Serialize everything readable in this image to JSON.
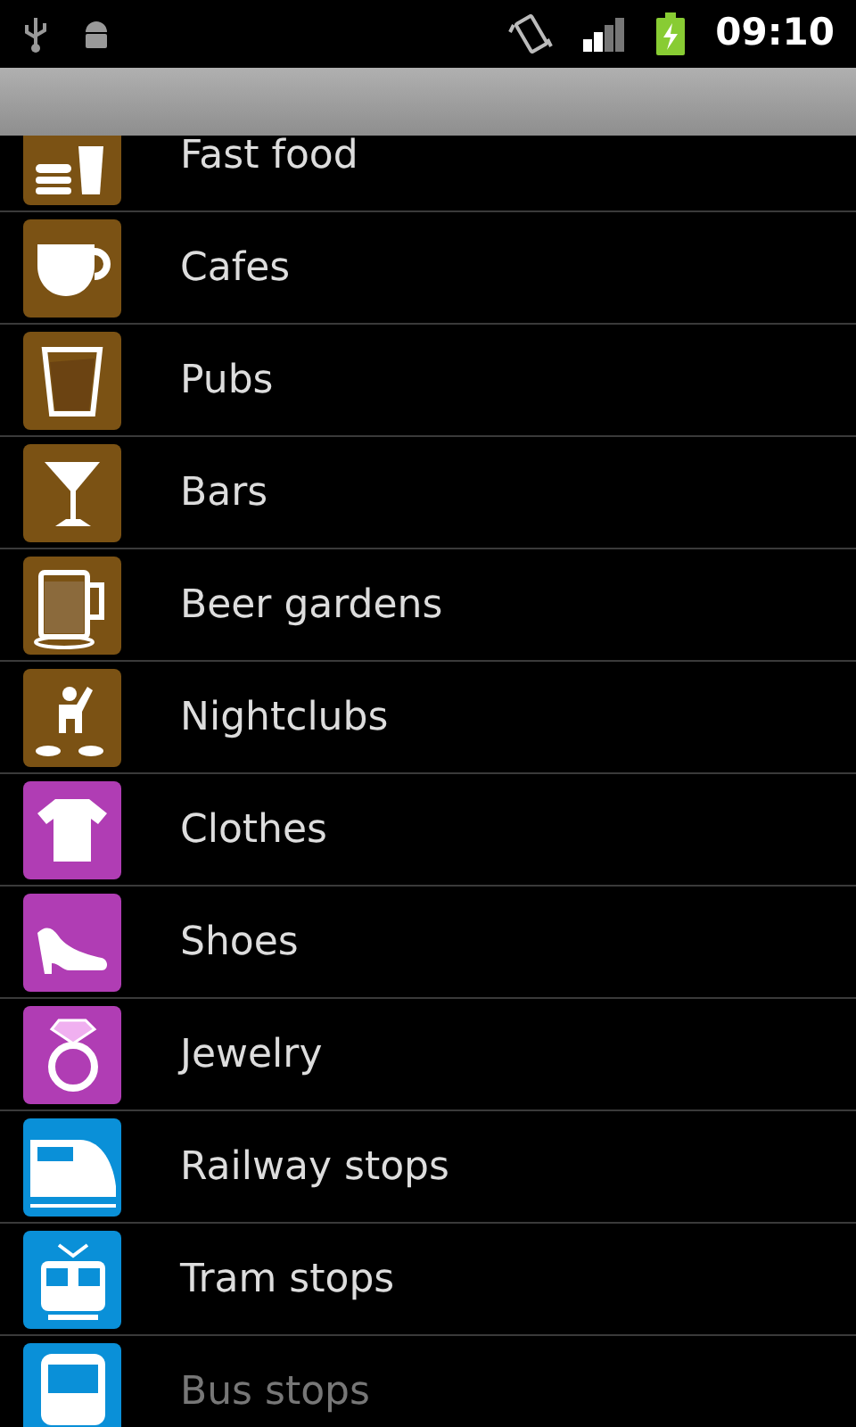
{
  "status_bar": {
    "time": "09:10"
  },
  "categories": [
    {
      "label": "Fast food",
      "kind": "fastfood",
      "color": "#7b5214"
    },
    {
      "label": "Cafes",
      "kind": "cup",
      "color": "#7b5214"
    },
    {
      "label": "Pubs",
      "kind": "glass",
      "color": "#7b5214"
    },
    {
      "label": "Bars",
      "kind": "cocktail",
      "color": "#7b5214"
    },
    {
      "label": "Beer gardens",
      "kind": "mug",
      "color": "#7b5214"
    },
    {
      "label": "Nightclubs",
      "kind": "dj",
      "color": "#7b5214"
    },
    {
      "label": "Clothes",
      "kind": "shirt",
      "color": "#b03db4"
    },
    {
      "label": "Shoes",
      "kind": "shoe",
      "color": "#b03db4"
    },
    {
      "label": "Jewelry",
      "kind": "ring",
      "color": "#b03db4"
    },
    {
      "label": "Railway stops",
      "kind": "train",
      "color": "#0a90d8"
    },
    {
      "label": "Tram stops",
      "kind": "tram",
      "color": "#0a90d8"
    },
    {
      "label": "Bus stops",
      "kind": "bus",
      "color": "#0a90d8"
    }
  ]
}
